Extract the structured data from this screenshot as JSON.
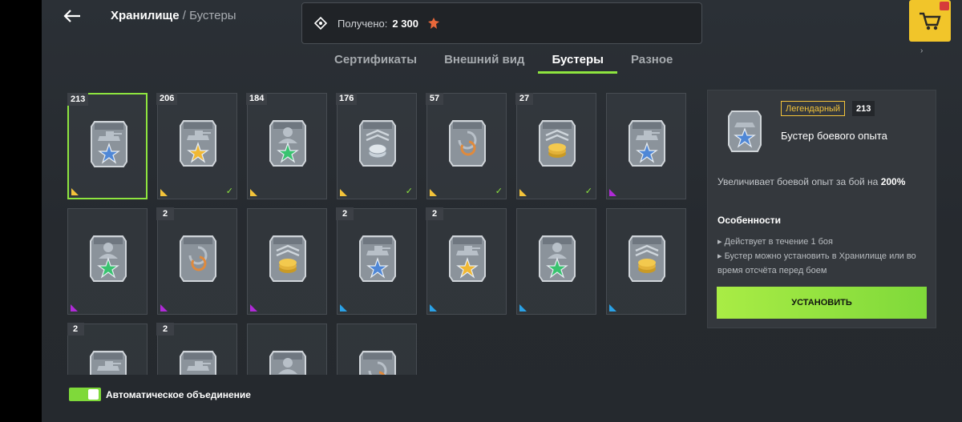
{
  "header": {
    "breadcrumb_root": "Хранилище",
    "breadcrumb_sep": "/",
    "breadcrumb_current": "Бустеры",
    "received_label": "Получено:",
    "received_value": "2 300"
  },
  "tabs": [
    {
      "label": "Сертификаты",
      "active": false
    },
    {
      "label": "Внешний вид",
      "active": false
    },
    {
      "label": "Бустеры",
      "active": true
    },
    {
      "label": "Разное",
      "active": false
    }
  ],
  "colors": {
    "accent": "#8ee53f",
    "legendary": "#f3c33a",
    "epic": "#b02ad8",
    "rare": "#2aa1e6",
    "silver_star": "#4f87d6",
    "gold_star": "#f0b834",
    "green_star": "#39c36f"
  },
  "boosters": [
    {
      "count": "213",
      "rarity": "legendary",
      "kind": "tank",
      "star": "silver_star",
      "checked": false,
      "selected": true
    },
    {
      "count": "206",
      "rarity": "legendary",
      "kind": "tank",
      "star": "gold_star",
      "checked": true,
      "selected": false
    },
    {
      "count": "184",
      "rarity": "legendary",
      "kind": "crew",
      "star": "green_star",
      "checked": false,
      "selected": false
    },
    {
      "count": "176",
      "rarity": "legendary",
      "kind": "silver",
      "star": "",
      "checked": true,
      "selected": false
    },
    {
      "count": "57",
      "rarity": "legendary",
      "kind": "free",
      "star": "",
      "checked": true,
      "selected": false
    },
    {
      "count": "27",
      "rarity": "legendary",
      "kind": "credits",
      "star": "",
      "checked": true,
      "selected": false
    },
    {
      "count": "",
      "rarity": "epic",
      "kind": "tank",
      "star": "silver_star",
      "checked": false,
      "selected": false
    },
    {
      "count": "",
      "rarity": "epic",
      "kind": "crew",
      "star": "green_star",
      "checked": false,
      "selected": false
    },
    {
      "count": "2",
      "rarity": "epic",
      "kind": "free",
      "star": "",
      "checked": false,
      "selected": false
    },
    {
      "count": "",
      "rarity": "epic",
      "kind": "credits",
      "star": "",
      "checked": false,
      "selected": false
    },
    {
      "count": "2",
      "rarity": "rare",
      "kind": "tank",
      "star": "silver_star",
      "checked": false,
      "selected": false
    },
    {
      "count": "2",
      "rarity": "rare",
      "kind": "tank",
      "star": "gold_star",
      "checked": false,
      "selected": false
    },
    {
      "count": "",
      "rarity": "rare",
      "kind": "crew",
      "star": "green_star",
      "checked": false,
      "selected": false
    },
    {
      "count": "",
      "rarity": "rare",
      "kind": "credits",
      "star": "",
      "checked": false,
      "selected": false
    },
    {
      "count": "2",
      "rarity": "rare",
      "kind": "tank",
      "star": "",
      "checked": false,
      "selected": false
    },
    {
      "count": "2",
      "rarity": "rare",
      "kind": "tank",
      "star": "",
      "checked": false,
      "selected": false
    },
    {
      "count": "",
      "rarity": "rare",
      "kind": "crew",
      "star": "",
      "checked": false,
      "selected": false
    },
    {
      "count": "",
      "rarity": "rare",
      "kind": "free",
      "star": "",
      "checked": false,
      "selected": false
    }
  ],
  "panel": {
    "rarity": "Легендарный",
    "count": "213",
    "name": "Бустер боевого опыта",
    "desc_prefix": "Увеличивает боевой опыт за бой на",
    "desc_value": "200%",
    "features_title": "Особенности",
    "features": [
      "Действует в течение 1 боя",
      "Бустер можно установить в Хранилище или во время отсчёта перед боем"
    ],
    "install_label": "УСТАНОВИТЬ"
  },
  "auto_merge": {
    "label": "Автоматическое объединение",
    "enabled": true
  }
}
